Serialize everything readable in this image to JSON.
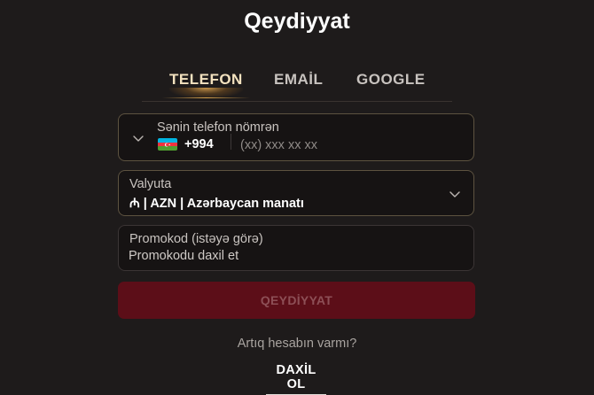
{
  "page": {
    "title": "Qeydiyyat"
  },
  "tabs": [
    {
      "label": "TELEFON",
      "active": true
    },
    {
      "label": "EMAİL",
      "active": false
    },
    {
      "label": "GOOGLE",
      "active": false
    }
  ],
  "phone": {
    "label": "Sənin telefon nömrən",
    "country_code": "+994",
    "flag": "azerbaijan-flag",
    "placeholder": "(xx) xxx xx xx"
  },
  "currency": {
    "label": "Valyuta",
    "symbol": "₼",
    "value": "| AZN | Azərbaycan manatı"
  },
  "promo": {
    "label": "Promokod (istəyə görə)",
    "placeholder": "Promokodu daxil et"
  },
  "submit": {
    "label": "QEYDİYYAT"
  },
  "footer": {
    "question": "Artıq hesabın varmı?",
    "login_label": "DAXİL OL"
  },
  "colors": {
    "background": "#1e1b1b",
    "accent_gold": "#d9a44e",
    "submit_bg": "#5c0e18",
    "flag_blue": "#00b5e2",
    "flag_red": "#ef3340",
    "flag_green": "#509e2f"
  }
}
